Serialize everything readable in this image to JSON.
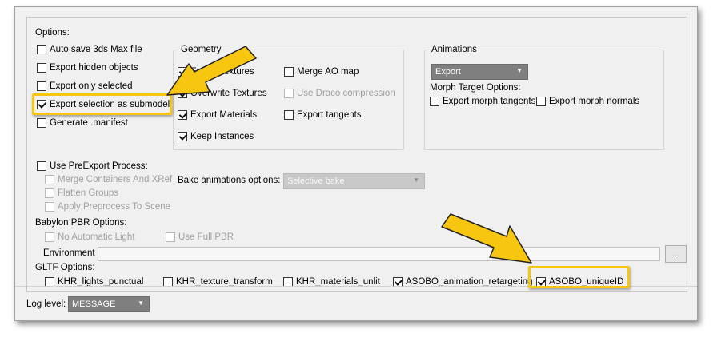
{
  "options": {
    "title": "Options:",
    "auto_save": "Auto save 3ds Max file",
    "export_hidden": "Export hidden objects",
    "export_only_selected": "Export only selected",
    "export_selection_submodel": "Export selection as submodel",
    "generate_manifest": "Generate .manifest"
  },
  "geometry": {
    "title": "Geometry",
    "export_textures": "Export Textures",
    "overwrite_textures": "Overwrite Textures",
    "export_materials": "Export Materials",
    "keep_instances": "Keep Instances",
    "merge_ao_map": "Merge AO map",
    "use_draco": "Use Draco compression",
    "export_tangents": "Export tangents"
  },
  "animations": {
    "title": "Animations",
    "export_dropdown": "Export",
    "morph_title": "Morph Target Options:",
    "export_morph_tangents": "Export morph tangents",
    "export_morph_normals": "Export morph normals"
  },
  "preexport": {
    "use_preexport": "Use PreExport Process:",
    "merge_containers": "Merge Containers And XRef",
    "flatten_groups": "Flatten Groups",
    "apply_preprocess": "Apply Preprocess To Scene",
    "bake_label": "Bake animations options:",
    "bake_value": "Selective bake"
  },
  "pbr": {
    "title": "Babylon PBR Options:",
    "no_automatic_light": "No Automatic Light",
    "use_full_pbr": "Use Full PBR",
    "environment_label": "Environment",
    "environment_value": "",
    "browse_label": "..."
  },
  "gltf": {
    "title": "GLTF Options:",
    "khr_lights": "KHR_lights_punctual",
    "khr_texture": "KHR_texture_transform",
    "khr_unlit": "KHR_materials_unlit",
    "asobo_anim": "ASOBO_animation_retargeting",
    "asobo_uid": "ASOBO_uniqueID"
  },
  "log": {
    "label": "Log level:",
    "value": "MESSAGE"
  },
  "colors": {
    "highlight": "#f6c611",
    "window_bg": "#f0f0f0"
  }
}
